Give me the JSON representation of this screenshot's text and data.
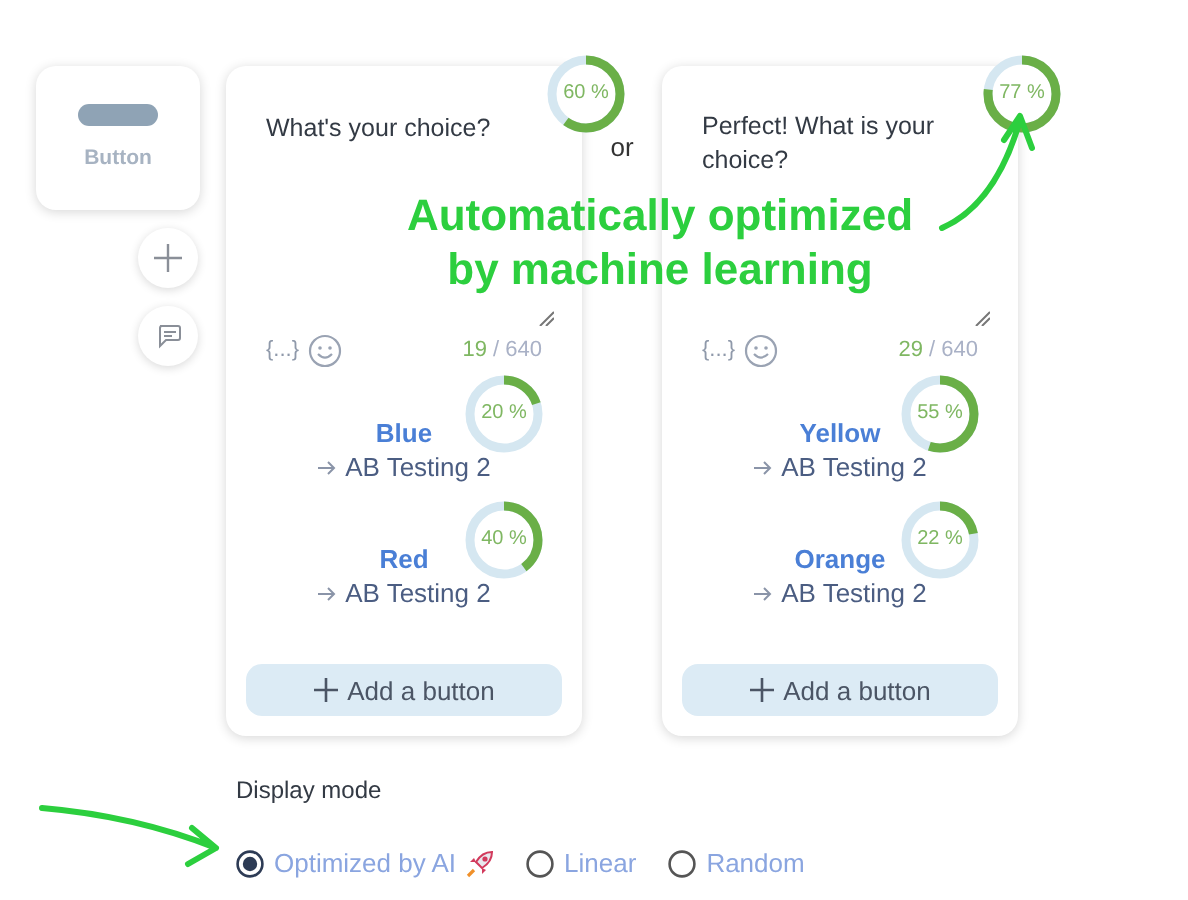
{
  "tile": {
    "label": "Button"
  },
  "cards": [
    {
      "rate": {
        "text": "60 %",
        "level": 0.6
      },
      "question": "What's your choice?",
      "variable": "{...}",
      "count": "19",
      "max": "/ 640",
      "add_button": "Add a button",
      "buttons": [
        {
          "label": "Blue",
          "rate": "20 %",
          "level": 0.2,
          "target": "AB Testing 2"
        },
        {
          "label": "Red",
          "rate": "40 %",
          "level": 0.4,
          "target": "AB Testing 2"
        }
      ]
    },
    {
      "rate": {
        "text": "77 %",
        "level": 0.77
      },
      "question": "Perfect! What is your choice?",
      "variable": "{...}",
      "count": "29",
      "max": "/ 640",
      "add_button": "Add a button",
      "buttons": [
        {
          "label": "Yellow",
          "rate": "55 %",
          "level": 0.55,
          "target": "AB Testing 2"
        },
        {
          "label": "Orange",
          "rate": "22 %",
          "level": 0.22,
          "target": "AB Testing 2"
        }
      ]
    }
  ],
  "separator": "or",
  "annotation": [
    "Automatically optimized",
    "by machine learning"
  ],
  "display_mode": {
    "label": "Display mode",
    "options": [
      {
        "label": "Optimized by AI",
        "selected": true,
        "rocket": true
      },
      {
        "label": "Linear",
        "selected": false,
        "rocket": false
      },
      {
        "label": "Random",
        "selected": false,
        "rocket": false
      }
    ]
  }
}
